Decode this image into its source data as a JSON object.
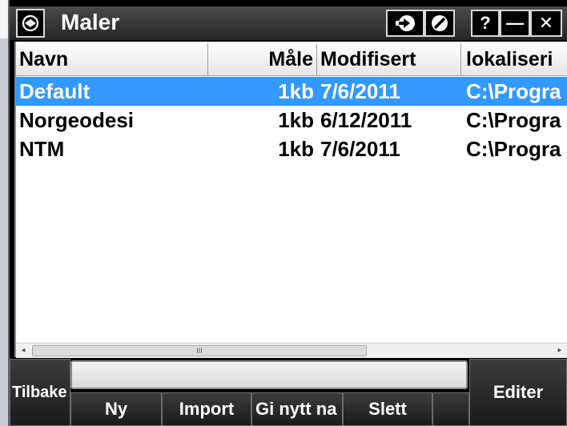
{
  "window": {
    "title": "Maler"
  },
  "titlebar": {
    "buttons": [
      {
        "icon": "arrow-right-circle-icon"
      },
      {
        "icon": "no-entry-icon"
      },
      {
        "label": "?"
      },
      {
        "label": "—"
      },
      {
        "label": "✕"
      }
    ]
  },
  "table": {
    "columns": [
      "Navn",
      "Måle",
      "Modifisert",
      "lokaliseri"
    ],
    "rows": [
      {
        "name": "Default",
        "size": "1kb",
        "modified": "7/6/2011",
        "location": "C:\\Progra",
        "selected": true
      },
      {
        "name": "Norgeodesi",
        "size": "1kb",
        "modified": "6/12/2011",
        "location": "C:\\Progra",
        "selected": false
      },
      {
        "name": "NTM",
        "size": "1kb",
        "modified": "7/6/2011",
        "location": "C:\\Progra",
        "selected": false
      }
    ]
  },
  "scrollbar": {
    "thumb_grip": "III",
    "left_arrow": "◂",
    "right_arrow": "▸"
  },
  "toolbar": {
    "back_label": "Tilbake",
    "new_label": "Ny",
    "import_label": "Import",
    "rename_label": "Gi nytt na",
    "delete_label": "Slett",
    "edit_label": "Editer"
  },
  "colors": {
    "selection": "#3399ff",
    "titlebar": "#333333",
    "toolbar": "#000000"
  }
}
